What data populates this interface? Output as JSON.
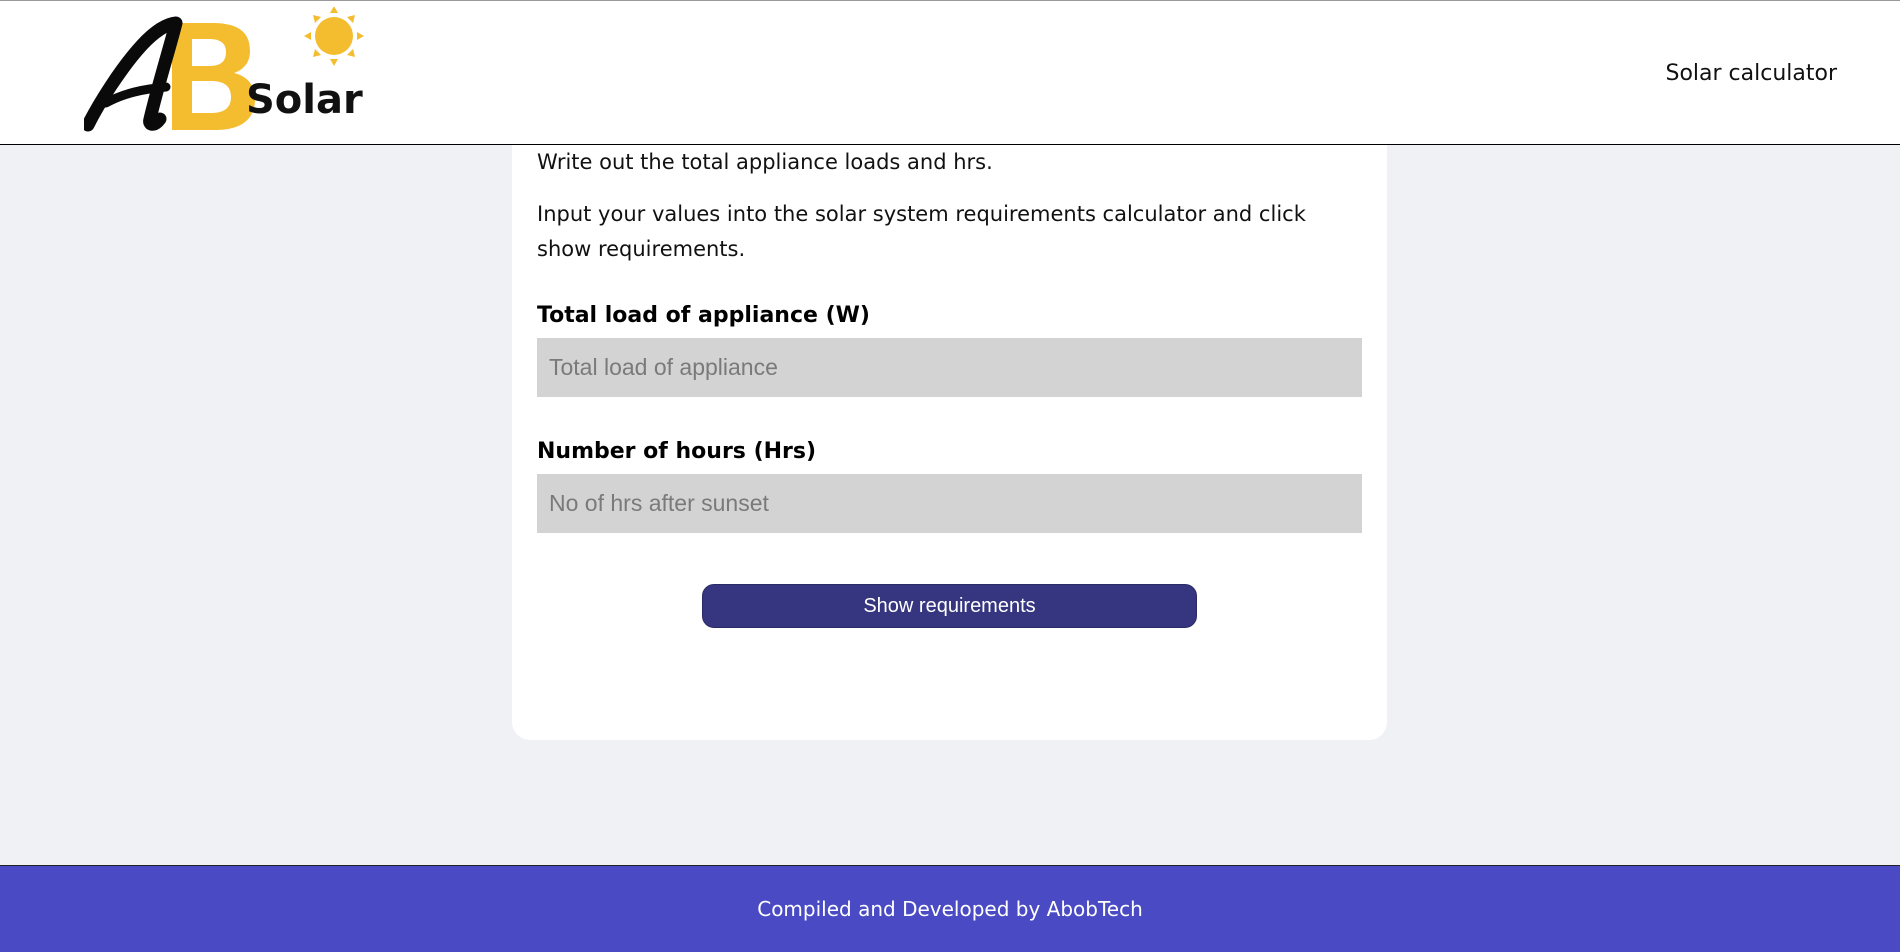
{
  "header": {
    "logo": {
      "letters": "AB",
      "word": "Solar",
      "icon": "sun-icon"
    },
    "nav_link": "Solar calculator"
  },
  "main": {
    "intro_lines": [
      "Write out the total appliance loads and hrs.",
      "Input your values into the solar system requirements calculator and click show requirements."
    ],
    "fields": [
      {
        "label": "Total load of appliance (W)",
        "placeholder": "Total load of appliance",
        "value": ""
      },
      {
        "label": "Number of hours (Hrs)",
        "placeholder": "No of hrs after sunset",
        "value": ""
      }
    ],
    "submit_label": "Show requirements"
  },
  "footer": {
    "text": "Compiled and Developed by AbobTech"
  },
  "colors": {
    "page_bg": "#f0f1f5",
    "accent_yellow": "#f4bd30",
    "button": "#36357f",
    "footer": "#4a4bc4",
    "input_bg": "#d3d3d3"
  }
}
